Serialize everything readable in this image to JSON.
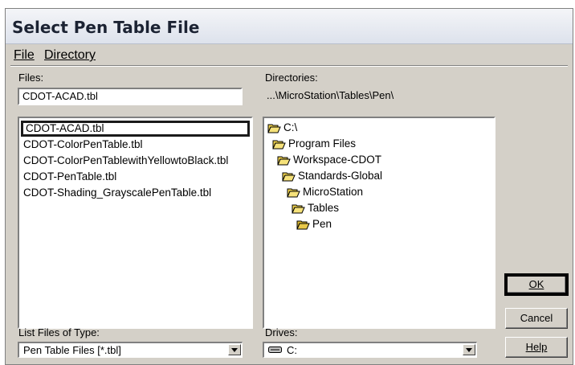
{
  "window": {
    "title": "Select Pen Table File"
  },
  "menu": [
    {
      "label": "File"
    },
    {
      "label": "Directory"
    }
  ],
  "files": {
    "label": "Files:",
    "value": "CDOT-ACAD.tbl",
    "items": [
      "CDOT-ACAD.tbl",
      "CDOT-ColorPenTable.tbl",
      "CDOT-ColorPenTablewithYellowtoBlack.tbl",
      "CDOT-PenTable.tbl",
      "CDOT-Shading_GrayscalePenTable.tbl"
    ],
    "selected_index": 0
  },
  "directories": {
    "label": "Directories:",
    "path": "...\\MicroStation\\Tables\\Pen\\",
    "items": [
      {
        "name": "C:\\",
        "icon": "open-folder-icon"
      },
      {
        "name": "Program Files",
        "icon": "open-folder-icon"
      },
      {
        "name": "Workspace-CDOT",
        "icon": "open-folder-icon"
      },
      {
        "name": "Standards-Global",
        "icon": "open-folder-icon"
      },
      {
        "name": "MicroStation",
        "icon": "open-folder-icon"
      },
      {
        "name": "Tables",
        "icon": "open-folder-icon"
      },
      {
        "name": "Pen",
        "icon": "open-folder-icon"
      }
    ]
  },
  "file_type": {
    "label": "List Files of Type:",
    "value": "Pen Table Files [*.tbl]"
  },
  "drives": {
    "label": "Drives:",
    "value": "C:",
    "icon": "drive-icon"
  },
  "buttons": {
    "ok": "OK",
    "cancel": "Cancel",
    "help": "Help"
  }
}
